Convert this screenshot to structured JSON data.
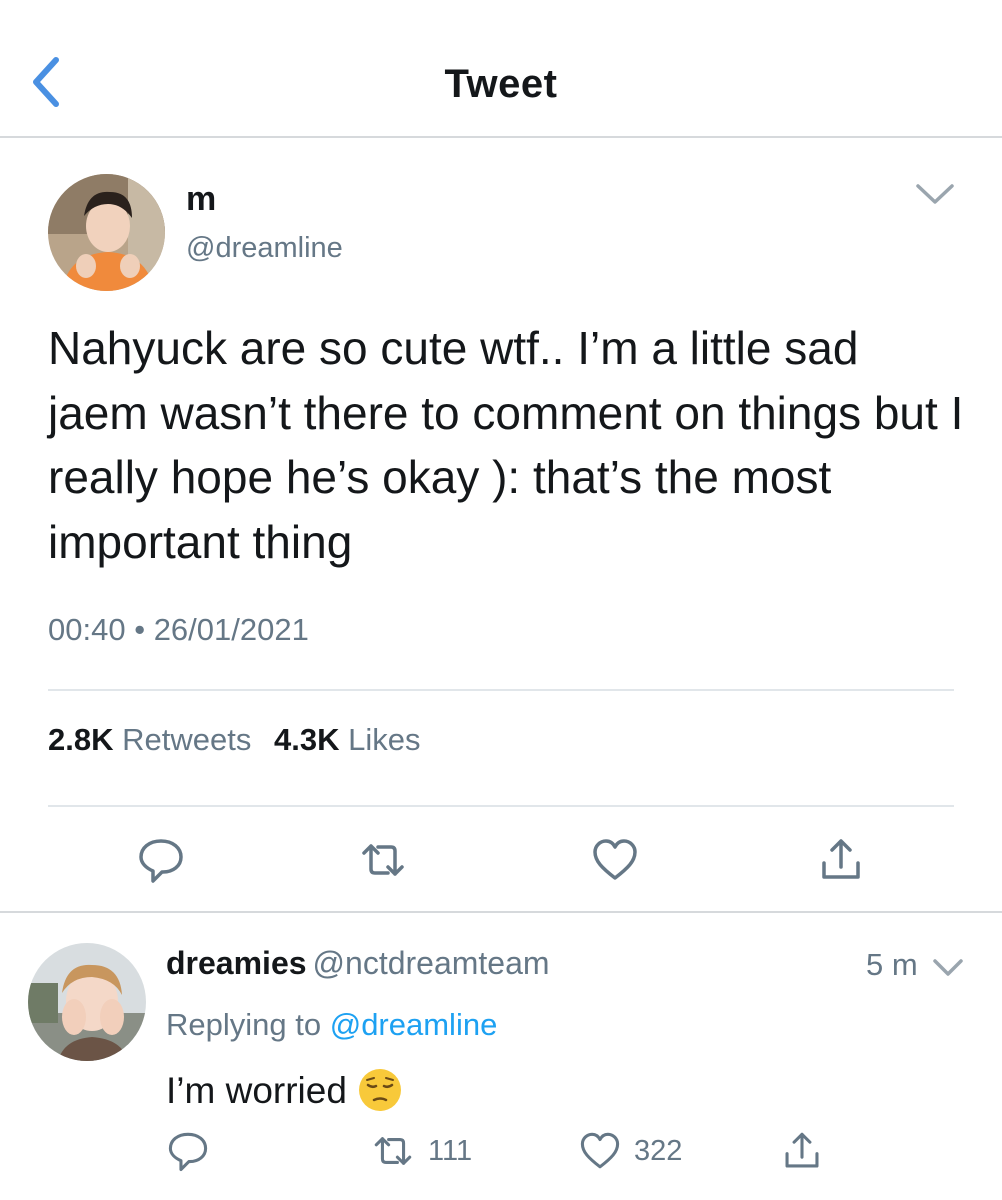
{
  "header": {
    "title": "Tweet",
    "back_icon": "chevron-left-icon"
  },
  "tweet": {
    "display_name": "m",
    "handle": "@dreamline",
    "text": "Nahyuck are so cute wtf.. I’m a little sad jaem wasn’t there to comment on things but I really hope he’s okay ): that’s the most important thing",
    "time": "00:40",
    "separator": "•",
    "date": "26/01/2021",
    "retweets_count": "2.8K",
    "retweets_label": "Retweets",
    "likes_count": "4.3K",
    "likes_label": "Likes",
    "actions": [
      "reply-icon",
      "retweet-icon",
      "like-icon",
      "share-icon"
    ]
  },
  "reply": {
    "display_name": "dreamies",
    "handle": "@nctdreamteam",
    "time": "5 m",
    "replying_prefix": "Replying to",
    "replying_to": "@dreamline",
    "text": "I’m worried",
    "emoji": "pensive-face-icon",
    "retweets": "111",
    "likes": "322"
  },
  "colors": {
    "accent": "#1da1f2",
    "secondary_text": "#657786",
    "primary_text": "#14171a",
    "divider": "#e1e6ea",
    "back_chevron": "#4a90e2"
  }
}
